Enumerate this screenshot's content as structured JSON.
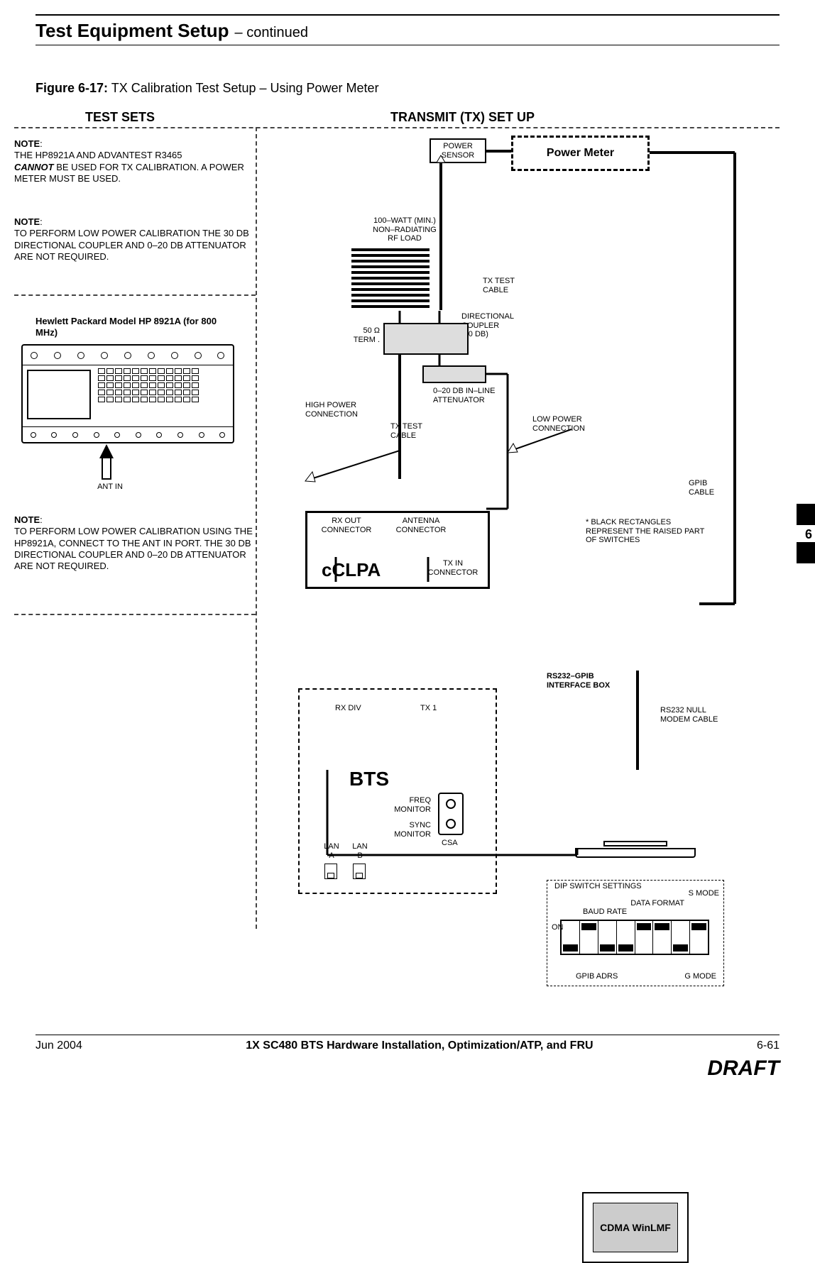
{
  "header": {
    "title": "Test Equipment Setup",
    "continued": "– continued"
  },
  "figure": {
    "label": "Figure 6-17:",
    "caption": "TX Calibration Test Setup – Using Power Meter"
  },
  "section_headers": {
    "test_sets": "TEST SETS",
    "tx_setup": "TRANSMIT (TX) SET UP"
  },
  "notes": {
    "n1_label": "NOTE",
    "n1_l1": "THE HP8921A AND ADVANTEST R3465",
    "n1_em": "CANNOT",
    "n1_l2": " BE USED FOR TX CALIBRATION. A POWER METER MUST BE USED.",
    "n2_label": "NOTE",
    "n2_body": "TO PERFORM LOW POWER CALIBRATION THE 30 DB DIRECTIONAL COUPLER AND 0–20 DB ATTENUATOR ARE NOT REQUIRED.",
    "n3_label": "NOTE",
    "n3_body": "TO PERFORM LOW POWER CALIBRATION USING THE HP8921A, CONNECT TO THE ANT IN PORT. THE 30 DB DIRECTIONAL COUPLER AND 0–20 DB ATTENUATOR ARE NOT REQUIRED."
  },
  "hp": {
    "title": "Hewlett Packard Model HP 8921A (for 800 MHz)",
    "ant_in": "ANT IN"
  },
  "labels": {
    "power_sensor": "POWER SENSOR",
    "power_meter": "Power  Meter",
    "rfload_l1": "100–WATT (MIN.)",
    "rfload_l2": "NON–RADIATING",
    "rfload_l3": "RF LOAD",
    "tx_test_cable": "TX TEST CABLE",
    "dir_coupler_l1": "DIRECTIONAL",
    "dir_coupler_l2": "COUPLER",
    "dir_coupler_l3": "(30 DB)",
    "term": "50 Ω TERM .",
    "attn_l1": "0–20 DB IN–LINE",
    "attn_l2": "ATTENUATOR",
    "high_pwr": "HIGH POWER CONNECTION",
    "low_pwr": "LOW POWER CONNECTION",
    "rx_out": "RX OUT CONNECTOR",
    "antenna_conn": "ANTENNA CONNECTOR",
    "tx_in": "TX IN CONNECTOR",
    "cclpa": "cCLPA",
    "rx_div": "RX DIV",
    "tx1": "TX 1",
    "bts": "BTS",
    "freq_mon": "FREQ MONITOR",
    "sync_mon": "SYNC MONITOR",
    "lan_a": "LAN A",
    "lan_b": "LAN B",
    "csa": "CSA",
    "gpib_cable": "GPIB CABLE",
    "switch_note": "* BLACK RECTANGLES REPRESENT THE RAISED PART OF SWITCHES",
    "dip_title": "DIP SWITCH SETTINGS",
    "s_mode": "S MODE",
    "data_fmt": "DATA FORMAT",
    "baud": "BAUD RATE",
    "on": "ON",
    "gpib_adrs": "GPIB ADRS",
    "g_mode": "G MODE",
    "iface_box": "RS232–GPIB INTERFACE BOX",
    "null_modem": "RS232 NULL MODEM CABLE",
    "cdma_lmf": "CDMA WinLMF"
  },
  "side_tab": {
    "num": "6"
  },
  "footer": {
    "date": "Jun 2004",
    "doc": "1X SC480 BTS Hardware Installation, Optimization/ATP, and FRU",
    "page": "6-61",
    "draft": "DRAFT"
  }
}
